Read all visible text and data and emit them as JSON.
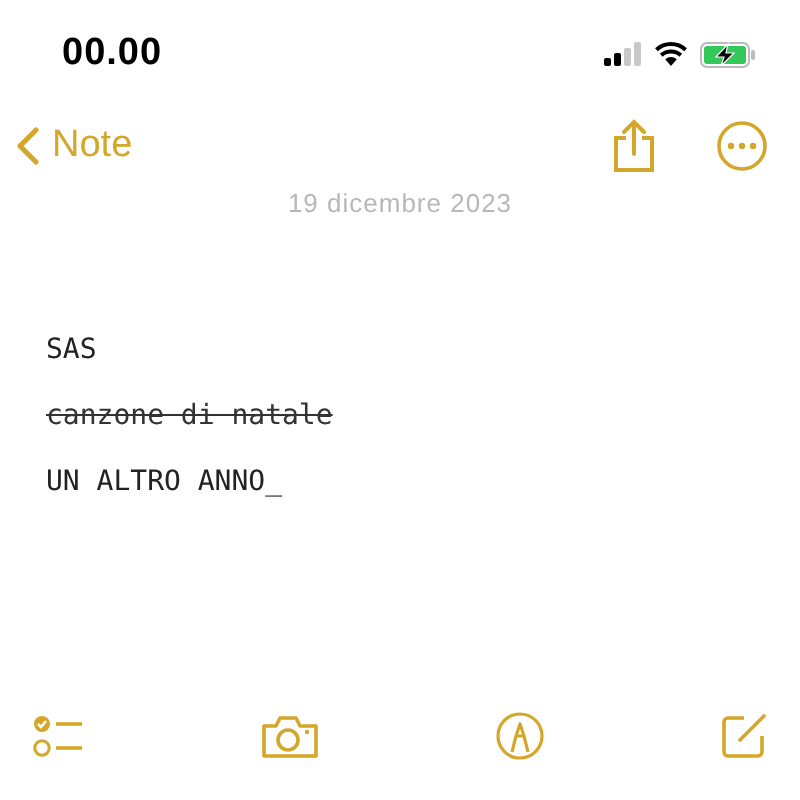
{
  "status_bar": {
    "time": "00.00"
  },
  "nav": {
    "back_label": "Note"
  },
  "note": {
    "date": "19 dicembre 2023",
    "lines": [
      {
        "text": "SAS",
        "struck": false
      },
      {
        "text": "canzone di natale",
        "struck": true
      },
      {
        "text": "UN ALTRO ANNO_",
        "struck": false
      }
    ]
  }
}
